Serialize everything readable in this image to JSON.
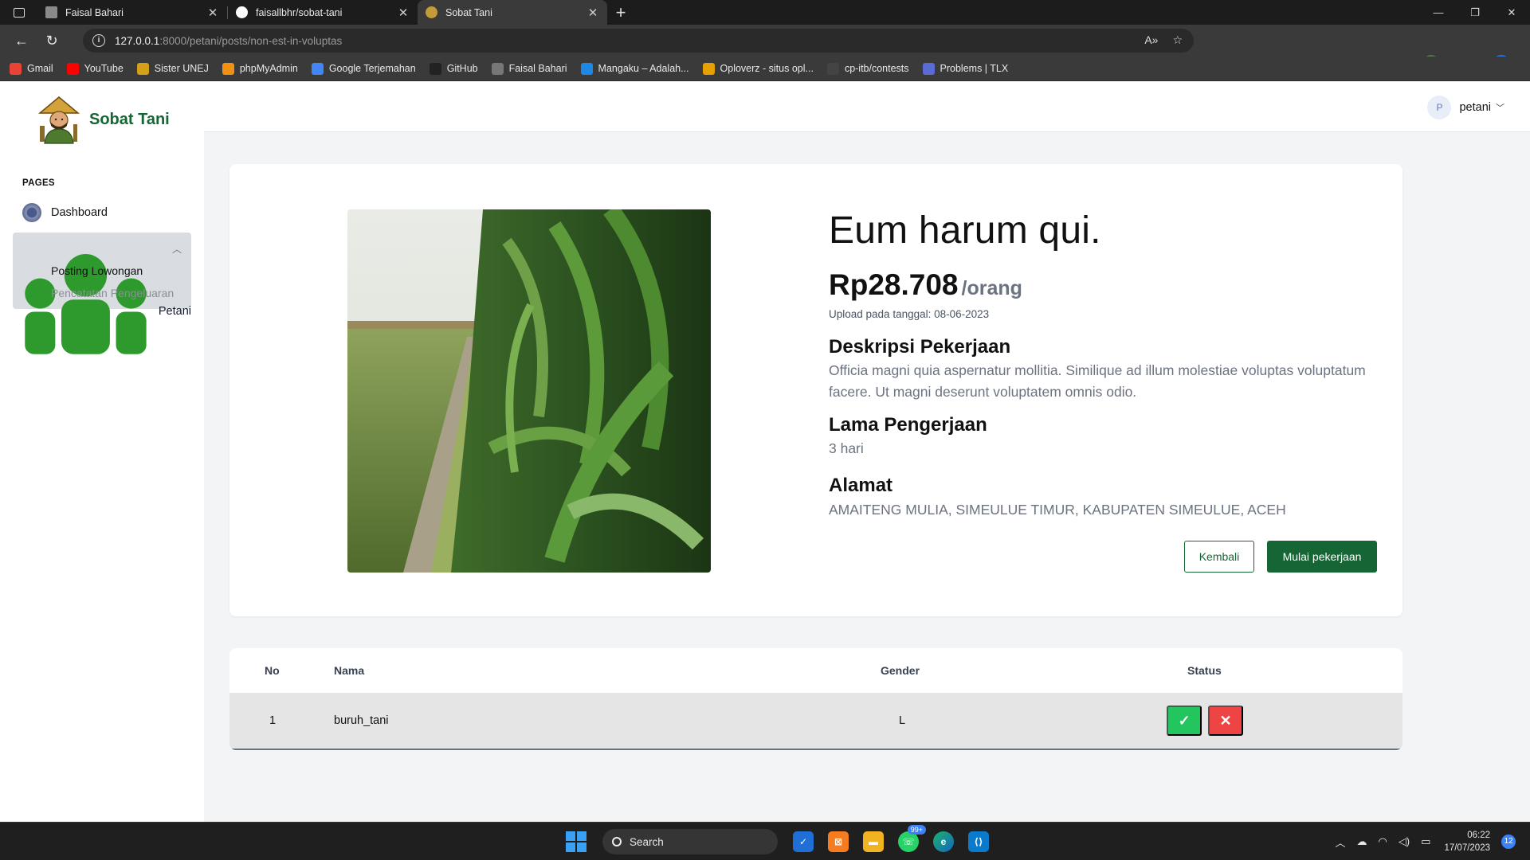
{
  "browser": {
    "tabs": [
      {
        "title": "Faisal Bahari",
        "active": false
      },
      {
        "title": "faisallbhr/sobat-tani",
        "active": false
      },
      {
        "title": "Sobat Tani",
        "active": true
      }
    ],
    "url_host": "127.0.0.1",
    "url_rest": ":8000/petani/posts/non-est-in-voluptas",
    "bookmarks": [
      {
        "label": "Gmail",
        "icon": "gmail-icon",
        "color": "#ea4335"
      },
      {
        "label": "YouTube",
        "icon": "youtube-icon",
        "color": "#ff0000"
      },
      {
        "label": "Sister UNEJ",
        "icon": "unej-icon",
        "color": "#d4a017"
      },
      {
        "label": "phpMyAdmin",
        "icon": "phpmyadmin-icon",
        "color": "#f29111"
      },
      {
        "label": "Google Terjemahan",
        "icon": "translate-icon",
        "color": "#4285f4"
      },
      {
        "label": "GitHub",
        "icon": "github-icon",
        "color": "#222222"
      },
      {
        "label": "Faisal Bahari",
        "icon": "profile-icon",
        "color": "#777777"
      },
      {
        "label": "Mangaku – Adalah...",
        "icon": "mangaku-icon",
        "color": "#1e88e5"
      },
      {
        "label": "Oploverz - situs opl...",
        "icon": "oploverz-icon",
        "color": "#e6a100"
      },
      {
        "label": "cp-itb/contests",
        "icon": "cp-itb-icon",
        "color": "#444444"
      },
      {
        "label": "Problems | TLX",
        "icon": "tlx-icon",
        "color": "#5b6bd6"
      }
    ]
  },
  "app": {
    "brand": "Sobat Tani",
    "sidebar": {
      "heading": "PAGES",
      "dashboard": "Dashboard",
      "petani": "Petani",
      "sub_items": [
        "Posting Lowongan",
        "Pencatatan Pengeluaran"
      ]
    },
    "user": {
      "initial": "P",
      "name": "petani"
    },
    "post": {
      "title": "Eum harum qui.",
      "price": "Rp28.708",
      "price_unit": "/orang",
      "upload": "Upload pada tanggal: 08-06-2023",
      "desc_heading": "Deskripsi Pekerjaan",
      "desc": "Officia magni quia aspernatur mollitia. Similique ad illum molestiae voluptas voluptatum facere. Ut magni deserunt voluptatem omnis odio.",
      "duration_heading": "Lama Pengerjaan",
      "duration": "3 hari",
      "address_heading": "Alamat",
      "address": "AMAITENG MULIA, SIMEULUE TIMUR, KABUPATEN SIMEULUE, ACEH",
      "back_label": "Kembali",
      "start_label": "Mulai pekerjaan"
    },
    "table": {
      "headers": [
        "No",
        "Nama",
        "Gender",
        "Status"
      ],
      "rows": [
        {
          "no": "1",
          "nama": "buruh_tani",
          "gender": "L"
        }
      ],
      "accept_color": "#22c55e",
      "reject_color": "#ef4444"
    }
  },
  "taskbar": {
    "search": "Search",
    "whatsapp_badge": "99+",
    "time": "06:22",
    "date": "17/07/2023",
    "notifications": "12"
  }
}
